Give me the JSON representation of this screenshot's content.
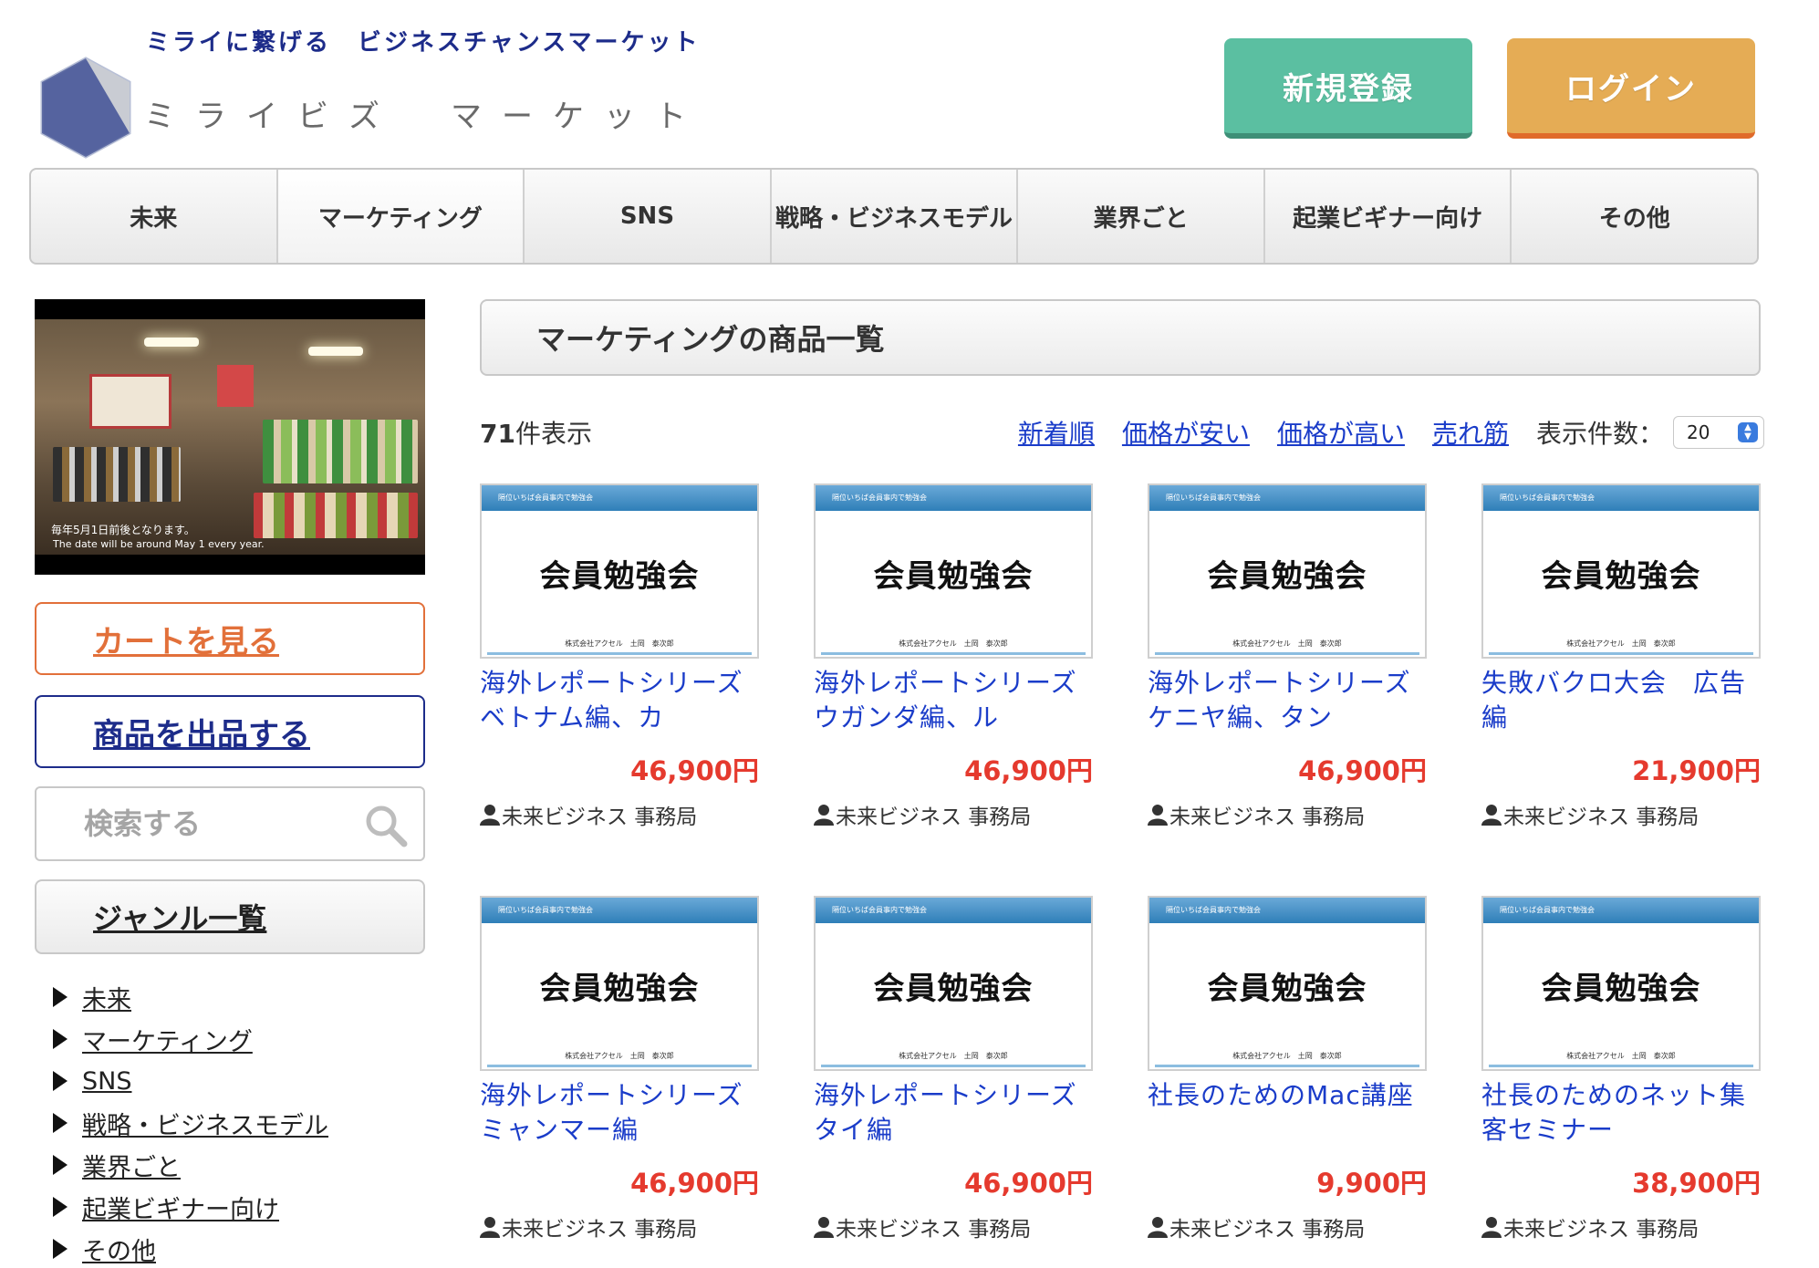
{
  "header": {
    "tagline": "ミライに繋げる　ビジネスチャンスマーケット",
    "logo_text": "ミライビズ　マーケット",
    "register_label": "新規登録",
    "login_label": "ログイン"
  },
  "nav": {
    "items": [
      {
        "label": "未来"
      },
      {
        "label": "マーケティング"
      },
      {
        "label": "SNS"
      },
      {
        "label": "戦略・ビジネスモデル"
      },
      {
        "label": "業界ごと"
      },
      {
        "label": "起業ビギナー向け"
      },
      {
        "label": "その他"
      }
    ],
    "active_index": 1
  },
  "sidebar": {
    "video_caption_jp": "毎年5月1日前後となります。",
    "video_caption_en": "The date will be around May 1 every year.",
    "cart_label": "カートを見る",
    "sell_label": "商品を出品する",
    "search_placeholder": "検索する",
    "genre_heading": "ジャンル一覧",
    "genres": [
      {
        "label": "未来"
      },
      {
        "label": "マーケティング"
      },
      {
        "label": "SNS"
      },
      {
        "label": "戦略・ビジネスモデル"
      },
      {
        "label": "業界ごと"
      },
      {
        "label": "起業ビギナー向け"
      },
      {
        "label": "その他"
      }
    ]
  },
  "main": {
    "title": "マーケティングの商品一覧",
    "count_number": "71",
    "count_suffix": "件表示",
    "sorts": [
      {
        "label": "新着順"
      },
      {
        "label": "価格が安い"
      },
      {
        "label": "価格が高い"
      },
      {
        "label": "売れ筋"
      }
    ],
    "per_page_label": "表示件数：",
    "per_page_value": "20"
  },
  "thumb": {
    "title": "会員勉強会",
    "bar_text": "隔位いちば会員事内で勉強会",
    "foot_text": "株式会社アクセル　土岡　泰次郎"
  },
  "products": [
    {
      "name": "海外レポートシリーズ　ベトナム編、カ",
      "price": "46,900円",
      "seller": "未来ビジネス 事務局"
    },
    {
      "name": "海外レポートシリーズ　ウガンダ編、ル",
      "price": "46,900円",
      "seller": "未来ビジネス 事務局"
    },
    {
      "name": "海外レポートシリーズ　ケニヤ編、タン",
      "price": "46,900円",
      "seller": "未来ビジネス 事務局"
    },
    {
      "name": "失敗バクロ大会　広告編",
      "price": "21,900円",
      "seller": "未来ビジネス 事務局"
    },
    {
      "name": "海外レポートシリーズ　ミャンマー編",
      "price": "46,900円",
      "seller": "未来ビジネス 事務局"
    },
    {
      "name": "海外レポートシリーズ　タイ編",
      "price": "46,900円",
      "seller": "未来ビジネス 事務局"
    },
    {
      "name": "社長のためのMac講座",
      "price": "9,900円",
      "seller": "未来ビジネス 事務局"
    },
    {
      "name": "社長のためのネット集客セミナー",
      "price": "38,900円",
      "seller": "未来ビジネス 事務局"
    }
  ],
  "colors": {
    "register": "#5bbfa1",
    "login": "#e5ac55",
    "link": "#1a3cc9",
    "price": "#e53a2e",
    "brand_navy": "#1d2c8a",
    "cart_orange": "#e2703a"
  }
}
